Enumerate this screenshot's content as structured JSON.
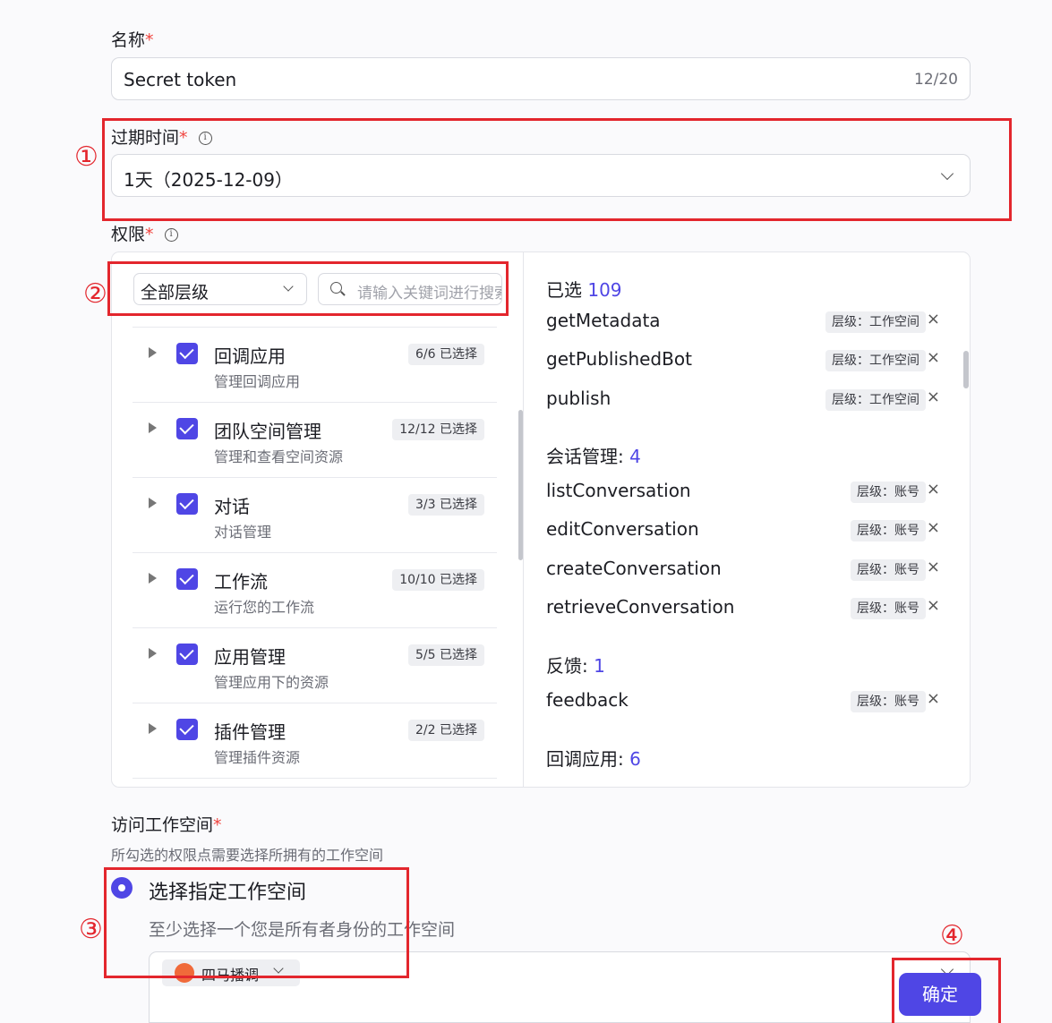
{
  "name_field": {
    "label": "名称",
    "required_mark": "*",
    "value": "Secret token",
    "counter": "12/20"
  },
  "expiry_field": {
    "label": "过期时间",
    "required_mark": "*",
    "info": "i",
    "value": "1天（2025-12-09）"
  },
  "permission_field": {
    "label": "权限",
    "required_mark": "*",
    "info": "i",
    "level_select": "全部层级",
    "search_placeholder": "请输入关键词进行搜索",
    "groups": [
      {
        "title": "回调应用",
        "subtitle": "管理回调应用",
        "badge": "6/6 已选择"
      },
      {
        "title": "团队空间管理",
        "subtitle": "管理和查看空间资源",
        "badge": "12/12 已选择"
      },
      {
        "title": "对话",
        "subtitle": "对话管理",
        "badge": "3/3 已选择"
      },
      {
        "title": "工作流",
        "subtitle": "运行您的工作流",
        "badge": "10/10 已选择"
      },
      {
        "title": "应用管理",
        "subtitle": "管理应用下的资源",
        "badge": "5/5 已选择"
      },
      {
        "title": "插件管理",
        "subtitle": "管理插件资源",
        "badge": "2/2 已选择"
      }
    ],
    "selected": {
      "label": "已选",
      "count": "109",
      "top_items": [
        {
          "name": "getMetadata",
          "tag": "层级：工作空间"
        },
        {
          "name": "getPublishedBot",
          "tag": "层级：工作空间"
        },
        {
          "name": "publish",
          "tag": "层级：工作空间"
        }
      ],
      "sections": [
        {
          "head": "会话管理:",
          "count": "4",
          "items": [
            {
              "name": "listConversation",
              "tag": "层级：账号"
            },
            {
              "name": "editConversation",
              "tag": "层级：账号"
            },
            {
              "name": "createConversation",
              "tag": "层级：账号"
            },
            {
              "name": "retrieveConversation",
              "tag": "层级：账号"
            }
          ]
        },
        {
          "head": "反馈:",
          "count": "1",
          "items": [
            {
              "name": "feedback",
              "tag": "层级：账号"
            }
          ]
        },
        {
          "head": "回调应用:",
          "count": "6",
          "items": []
        }
      ],
      "remove_glyph": "×"
    }
  },
  "workspace_field": {
    "label": "访问工作空间",
    "required_mark": "*",
    "hint": "所勾选的权限点需要选择所拥有的工作空间",
    "option_title": "选择指定工作空间",
    "option_desc": "至少选择一个您是所有者身份的工作空间",
    "chip": "四马播调"
  },
  "annotations": [
    "①",
    "②",
    "③",
    "④"
  ],
  "confirm_button": "确定",
  "colors": {
    "accent": "#4f46e5",
    "annotation": "#e3262d",
    "required": "#f0443f"
  }
}
